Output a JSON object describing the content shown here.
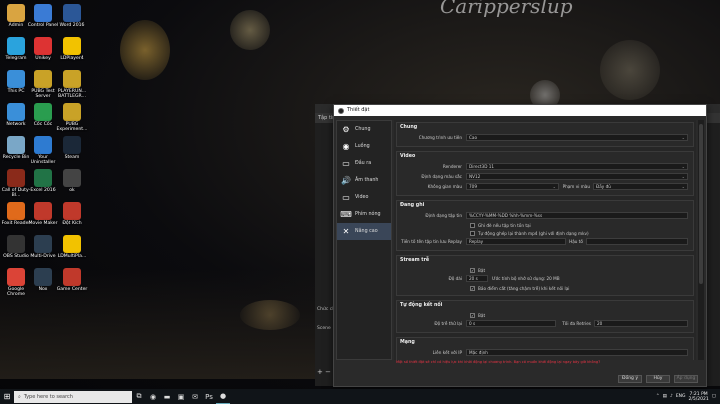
{
  "wallpaper": {
    "signature": "Caripperslup"
  },
  "desktop_icons": [
    {
      "label": "Admin",
      "icon": "user-folder-icon",
      "color": "#d9a441"
    },
    {
      "label": "Control Panel",
      "icon": "control-panel-icon",
      "color": "#3a7bd5"
    },
    {
      "label": "Word 2016",
      "icon": "word-icon",
      "color": "#2b5797"
    },
    {
      "label": "Telegram",
      "icon": "telegram-icon",
      "color": "#2aa3dd"
    },
    {
      "label": "Unikey",
      "icon": "unikey-icon",
      "color": "#d33"
    },
    {
      "label": "LDPlayer4",
      "icon": "ldplayer-icon",
      "color": "#f2c200"
    },
    {
      "label": "This PC",
      "icon": "computer-icon",
      "color": "#3a8fd9"
    },
    {
      "label": "PUBG Test Server",
      "icon": "pubg-icon",
      "color": "#c9a227"
    },
    {
      "label": "PLAYERUN... BATTLEGR...",
      "icon": "pubg-icon",
      "color": "#c9a227"
    },
    {
      "label": "Network",
      "icon": "network-icon",
      "color": "#3a8fd9"
    },
    {
      "label": "Cốc Cốc",
      "icon": "coccoc-icon",
      "color": "#2a9d4f"
    },
    {
      "label": "PUBG Experiment...",
      "icon": "pubg-icon",
      "color": "#c9a227"
    },
    {
      "label": "Recycle Bin",
      "icon": "recycle-bin-icon",
      "color": "#7aa7c7"
    },
    {
      "label": "Your Uninstaller",
      "icon": "uninstaller-icon",
      "color": "#2e7bd1"
    },
    {
      "label": "Steam",
      "icon": "steam-icon",
      "color": "#1b2838"
    },
    {
      "label": "Call of Duty-Bl...",
      "icon": "cod-icon",
      "color": "#8a2a1a"
    },
    {
      "label": "Excel 2016",
      "icon": "excel-icon",
      "color": "#217346"
    },
    {
      "label": "ok",
      "icon": "ok-icon",
      "color": "#444"
    },
    {
      "label": "Foxit Reader",
      "icon": "foxit-icon",
      "color": "#e06a1b"
    },
    {
      "label": "Movie Maker",
      "icon": "movie-maker-icon",
      "color": "#c0392b"
    },
    {
      "label": "Đột Kích",
      "icon": "game-icon",
      "color": "#c0392b"
    },
    {
      "label": "OBS Studio",
      "icon": "obs-icon",
      "color": "#333"
    },
    {
      "label": "Multi-Drive",
      "icon": "nox-icon",
      "color": "#2c3e50"
    },
    {
      "label": "LDMultiPla...",
      "icon": "ldplayer-icon",
      "color": "#f2c200"
    },
    {
      "label": "Google Chrome",
      "icon": "chrome-icon",
      "color": "#db4437"
    },
    {
      "label": "Nox",
      "icon": "nox-icon",
      "color": "#2c3e50"
    },
    {
      "label": "Game Center",
      "icon": "game-center-icon",
      "color": "#c0392b"
    }
  ],
  "obs_main": {
    "menu_first": "Tập tin",
    "scene_panel": "Chức ch",
    "scene_label": "Scene"
  },
  "settings": {
    "title": "Thiết đặt",
    "sidebar": [
      {
        "label": "Chung",
        "icon": "gear-icon",
        "glyph": "⚙"
      },
      {
        "label": "Luồng",
        "icon": "stream-icon",
        "glyph": "◉"
      },
      {
        "label": "Đầu ra",
        "icon": "output-icon",
        "glyph": "▭"
      },
      {
        "label": "Âm thanh",
        "icon": "audio-icon",
        "glyph": "🔊"
      },
      {
        "label": "Video",
        "icon": "monitor-icon",
        "glyph": "▭"
      },
      {
        "label": "Phím nóng",
        "icon": "keyboard-icon",
        "glyph": "⌨"
      },
      {
        "label": "Nâng cao",
        "icon": "tools-icon",
        "glyph": "✕"
      }
    ],
    "general": {
      "title": "Chung",
      "process_priority_label": "Chương trình ưu tiên",
      "process_priority_value": "Cao"
    },
    "video": {
      "title": "Video",
      "renderer_label": "Renderer",
      "renderer_value": "Direct3D 11",
      "color_format_label": "Định dạng màu sắc",
      "color_format_value": "NV12",
      "color_space_label": "Không gian màu",
      "color_space_value": "709",
      "color_range_label": "Phạm vi màu",
      "color_range_value": "Đầy đủ"
    },
    "recording": {
      "title": "Đang ghi",
      "filename_label": "Định dạng tập tin",
      "filename_value": "%CCYY-%MM-%DD %hh-%mm-%ss",
      "overwrite_label": "Ghi đè nếu tập tin tồn tại",
      "autoremux_label": "Tự động ghép lại thành mp4 (ghi với định dạng mkv)",
      "replay_prefix_label": "Tiền tố tên tập tin lưu Replay",
      "replay_prefix_value": "Replay",
      "replay_suffix_label": "Hậu tố"
    },
    "stream_delay": {
      "title": "Stream trễ",
      "enable_label": "Bật",
      "duration_label": "Độ dài",
      "duration_value": "20 s",
      "memory_text": "Ước tính bộ nhớ sử dụng: 20 MB",
      "preserve_label": "Bảo điểm cắt (tăng chậm trễ) khi kết nối lại"
    },
    "reconnect": {
      "title": "Tự động kết nối",
      "enable_label": "Bật",
      "retry_delay_label": "Độ trễ thử lại",
      "retry_delay_value": "0 s",
      "max_retries_label": "Tối đa Retries",
      "max_retries_value": "20"
    },
    "network": {
      "title": "Mạng",
      "bind_label": "Liên kết với IP",
      "bind_value": "Mặc định"
    },
    "warning": "Một số thiết đặt sẽ chỉ có hiệu lực khi khởi động lại chương trình. Bạn có muốn khởi động lại ngay bây giờ không?",
    "buttons": {
      "ok": "Đồng ý",
      "cancel": "Hủy",
      "apply": "Áp dụng"
    }
  },
  "taskbar": {
    "search_placeholder": "Type here to search",
    "pinned": [
      "task-view-icon",
      "chrome-icon",
      "file-explorer-icon",
      "store-icon",
      "mail-icon",
      "photoshop-icon",
      "obs-icon"
    ],
    "language": "ENG",
    "time": "7:21 PM",
    "date": "2/5/2021"
  }
}
